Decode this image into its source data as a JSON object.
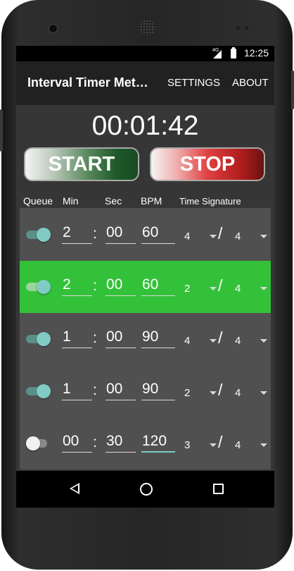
{
  "status": {
    "network": "4G",
    "time": "12:25"
  },
  "appbar": {
    "title": "Interval Timer Met…",
    "settings": "SETTINGS",
    "about": "ABOUT"
  },
  "timer": "00:01:42",
  "buttons": {
    "start": "START",
    "stop": "STOP"
  },
  "headers": {
    "queue": "Queue",
    "min": "Min",
    "sec": "Sec",
    "bpm": "BPM",
    "time_signature": "Time Signature"
  },
  "rows": [
    {
      "enabled": true,
      "active": false,
      "min": "2",
      "sec": "00",
      "bpm": "60",
      "beats": "4",
      "note": "4"
    },
    {
      "enabled": true,
      "active": true,
      "min": "2",
      "sec": "00",
      "bpm": "60",
      "beats": "2",
      "note": "4"
    },
    {
      "enabled": true,
      "active": false,
      "min": "1",
      "sec": "00",
      "bpm": "90",
      "beats": "4",
      "note": "4"
    },
    {
      "enabled": true,
      "active": false,
      "min": "1",
      "sec": "00",
      "bpm": "90",
      "beats": "2",
      "note": "4"
    },
    {
      "enabled": false,
      "active": false,
      "min": "00",
      "sec": "30",
      "bpm": "120",
      "beats": "3",
      "note": "4"
    }
  ],
  "separators": {
    "colon": ":",
    "slash": "/"
  },
  "colors": {
    "accent": "#80cbc4",
    "active_row": "#34c13a",
    "row_bg": "#505050",
    "appbar_bg": "#212121"
  },
  "icons": {
    "back": "back-icon",
    "home": "home-icon",
    "recents": "recents-icon"
  }
}
